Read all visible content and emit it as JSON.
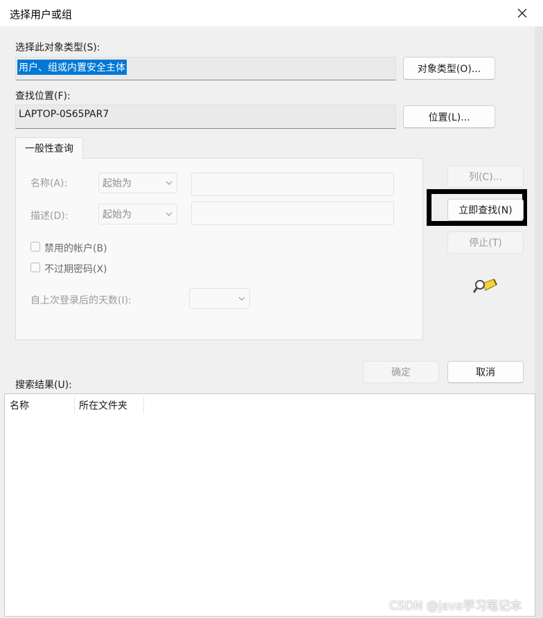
{
  "window": {
    "title": "选择用户或组",
    "close_icon": "close-icon"
  },
  "object_type": {
    "label": "选择此对象类型(S):",
    "value": "用户、组或内置安全主体",
    "button": "对象类型(O)..."
  },
  "location": {
    "label": "查找位置(F):",
    "value": "LAPTOP-0S65PAR7",
    "button": "位置(L)..."
  },
  "query": {
    "tab_label": "一般性查询",
    "name_label": "名称(A):",
    "name_mode": "起始为",
    "desc_label": "描述(D):",
    "desc_mode": "起始为",
    "disabled_accounts": "禁用的帐户(B)",
    "non_expiring_pwd": "不过期密码(X)",
    "days_since_logon": "自上次登录后的天数(I):"
  },
  "side_buttons": {
    "columns": "列(C)...",
    "find_now": "立即查找(N)",
    "stop": "停止(T)",
    "search_icon": "search-flashlight-icon"
  },
  "footer": {
    "ok": "确定",
    "cancel": "取消"
  },
  "results": {
    "label": "搜索结果(U):",
    "columns": [
      "名称",
      "所在文件夹"
    ]
  },
  "watermark": "CSDN @java学习笔记本",
  "colors": {
    "selection": "#0078d4",
    "highlight_border": "#000000",
    "background": "#f0f0f0"
  }
}
